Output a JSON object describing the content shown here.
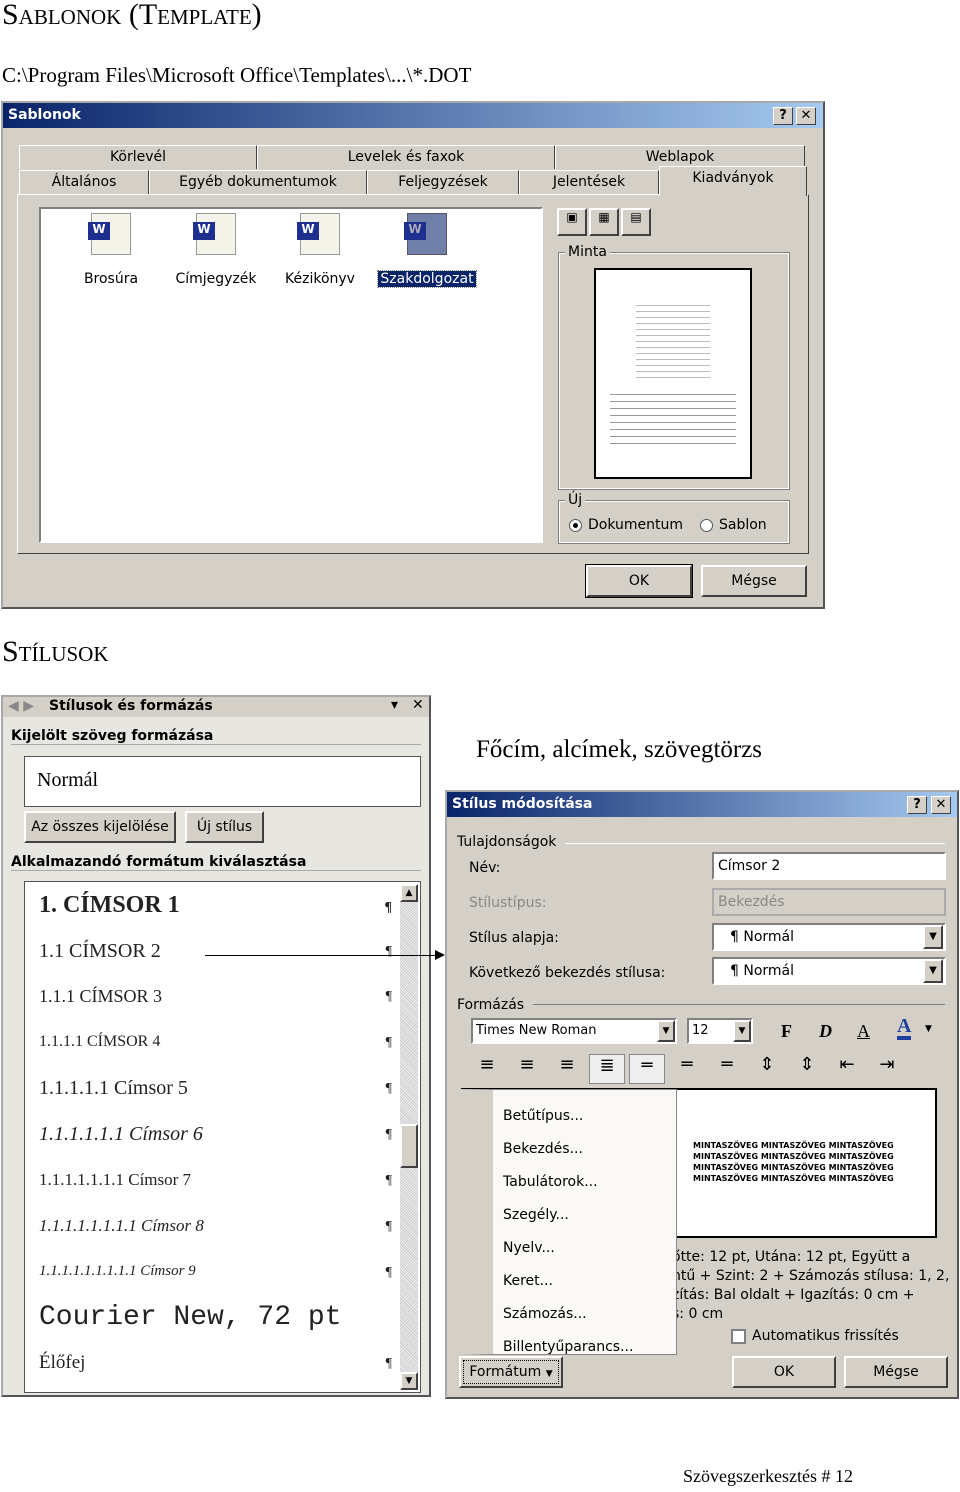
{
  "heading1": "Sablonok (Template)",
  "path": "C:\\Program Files\\Microsoft Office\\Templates\\...\\*.DOT",
  "templates_dialog": {
    "title": "Sablonok",
    "help": "?",
    "close": "✕",
    "tabs_row1": [
      "Körlevél",
      "Levelek és faxok",
      "Weblapok"
    ],
    "tabs_row2": [
      "Általános",
      "Egyéb dokumentumok",
      "Feljegyzések",
      "Jelentések",
      "Kiadványok"
    ],
    "active_tab": "Kiadványok",
    "items": [
      "Brosúra",
      "Címjegyzék",
      "Kézikönyv",
      "Szakdolgozat"
    ],
    "selected": "Szakdolgozat",
    "preview_label": "Minta",
    "new_label": "Új",
    "radio_document": "Dokumentum",
    "radio_template": "Sablon",
    "selected_radio": "Dokumentum",
    "ok": "OK",
    "cancel": "Mégse"
  },
  "heading2": "Stílusok",
  "styles_pane": {
    "title": "Stílusok és formázás",
    "selected_section": "Kijelölt szöveg formázása",
    "current_style": "Normál",
    "select_all": "Az összes kijelölése",
    "new_style": "Új stílus",
    "apply_section": "Alkalmazandó formátum kiválasztása",
    "styles": [
      "1.  CÍMSOR 1",
      "1.1  CÍMSOR 2",
      "1.1.1  CÍMSOR 3",
      "1.1.1.1  CÍMSOR 4",
      "1.1.1.1.1  Címsor 5",
      "1.1.1.1.1.1  Címsor 6",
      "1.1.1.1.1.1.1  Címsor 7",
      "1.1.1.1.1.1.1.1  Címsor 8",
      "1.1.1.1.1.1.1.1.1  Címsor 9",
      "Courier New, 72 pt",
      "Élőfej"
    ],
    "pilcrow": "¶"
  },
  "caption": "Főcím, alcímek, szövegtörzs",
  "modify_dialog": {
    "title": "Stílus módosítása",
    "help": "?",
    "close": "✕",
    "properties": "Tulajdonságok",
    "name_label": "Név:",
    "name_value": "Címsor 2",
    "type_label": "Stílustípus:",
    "type_value": "Bekezdés",
    "based_label": "Stílus alapja:",
    "based_value": "¶ Normál",
    "next_label": "Következő bekezdés stílusa:",
    "next_value": "¶ Normál",
    "formatting": "Formázás",
    "font": "Times New Roman",
    "size": "12",
    "bold": "F",
    "italic": "D",
    "underline": "A",
    "color": "A",
    "menu": [
      "Betűtípus...",
      "Bekezdés...",
      "Tabulátorok...",
      "Szegély...",
      "Nyelv...",
      "Keret...",
      "Számozás...",
      "Billentyűparancs..."
    ],
    "preview_sample": "MINTASZÖVEG MINTASZÖVEG MINTASZÖVEG",
    "desc": [
      "őtte:  12 pt, Utána:  12 pt, Együtt a",
      "ntű + Szint: 2 + Számozás stílusa: 1, 2,",
      "zítás: Bal oldalt + Igazítás:  0 cm +",
      "s:  0 cm"
    ],
    "auto_update": "Automatikus frissítés",
    "format_button": "Formátum",
    "ok": "OK",
    "cancel": "Mégse"
  },
  "footer": "Szövegszerkesztés # 12",
  "colors": {
    "titlebar": "#0a246a",
    "dialog": "#d4d0c8",
    "selection": "#0a246a"
  }
}
